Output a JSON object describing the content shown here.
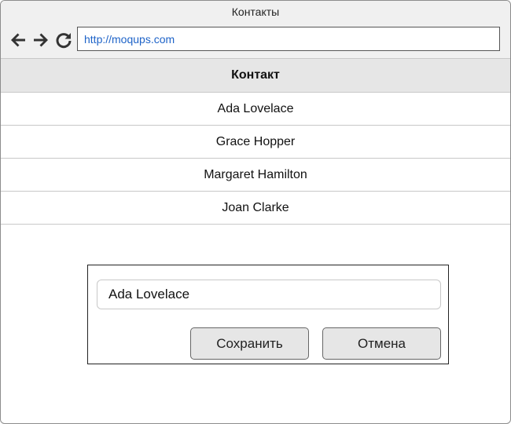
{
  "window": {
    "title": "Контакты"
  },
  "browser": {
    "url": "http://moqups.com",
    "back_icon": "arrow-left-icon",
    "forward_icon": "arrow-right-icon",
    "reload_icon": "reload-icon"
  },
  "contacts_table": {
    "header": "Контакт",
    "rows": [
      {
        "name": "Ada Lovelace"
      },
      {
        "name": "Grace Hopper"
      },
      {
        "name": "Margaret Hamilton"
      },
      {
        "name": "Joan Clarke"
      }
    ]
  },
  "edit_dialog": {
    "name_value": "Ada Lovelace",
    "save_label": "Сохранить",
    "cancel_label": "Отмена"
  },
  "colors": {
    "url_text": "#1e63c8",
    "header_bg": "#e6e6e6",
    "button_bg": "#e6e6e6"
  }
}
